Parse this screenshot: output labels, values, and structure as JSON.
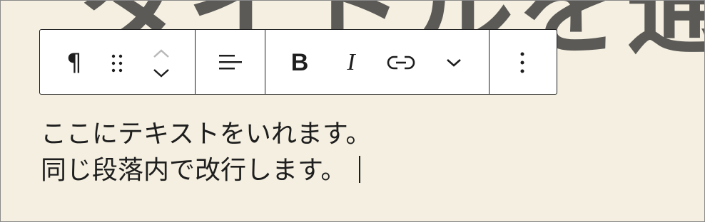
{
  "background_title": "タイトルを通",
  "toolbar": {
    "paragraph_symbol": "¶",
    "bold_label": "B",
    "italic_label": "I"
  },
  "content": {
    "line1": "ここにテキストをいれます。",
    "line2": "同じ段落内で改行します。"
  },
  "colors": {
    "background": "#f4efe0",
    "toolbar_bg": "#ffffff",
    "text": "#1e1e1e",
    "title_text": "#5b5a57"
  }
}
